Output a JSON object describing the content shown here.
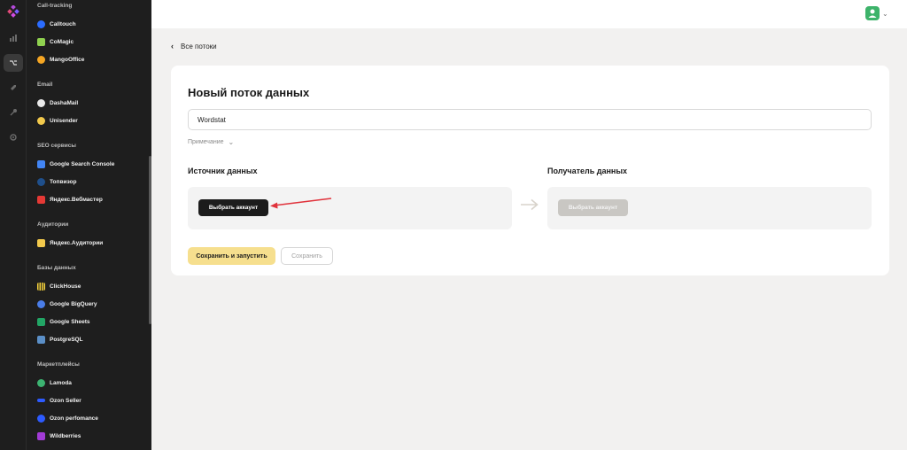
{
  "sidebar": {
    "sections": [
      {
        "title": "Call-tracking",
        "items": [
          {
            "label": "Calltouch",
            "icon": "calltouch-icon",
            "color": "#2b6cff"
          },
          {
            "label": "CoMagic",
            "icon": "comagic-icon",
            "color": "#8fd14f"
          },
          {
            "label": "MangoOffice",
            "icon": "mangooffice-icon",
            "color": "#f5a623"
          }
        ]
      },
      {
        "title": "Email",
        "items": [
          {
            "label": "DashaMail",
            "icon": "dashamail-icon",
            "color": "#e8e8e8"
          },
          {
            "label": "Unisender",
            "icon": "unisender-icon",
            "color": "#f2c94c"
          }
        ]
      },
      {
        "title": "SEO сервисы",
        "items": [
          {
            "label": "Google Search Console",
            "icon": "google-search-console-icon",
            "color": "#4285f4"
          },
          {
            "label": "Топвизор",
            "icon": "topvisor-icon",
            "color": "#1f4f8b"
          },
          {
            "label": "Яндекс.Вебмастер",
            "icon": "yandex-webmaster-icon",
            "color": "#e53935"
          }
        ]
      },
      {
        "title": "Аудитории",
        "items": [
          {
            "label": "Яндекс.Аудитории",
            "icon": "yandex-audiences-icon",
            "color": "#f2c94c"
          }
        ]
      },
      {
        "title": "Базы данных",
        "items": [
          {
            "label": "ClickHouse",
            "icon": "clickhouse-icon",
            "color": "#f6d33c"
          },
          {
            "label": "Google BigQuery",
            "icon": "google-bigquery-icon",
            "color": "#4a7de8"
          },
          {
            "label": "Google Sheets",
            "icon": "google-sheets-icon",
            "color": "#22a565"
          },
          {
            "label": "PostgreSQL",
            "icon": "postgresql-icon",
            "color": "#5b8fc7"
          }
        ]
      },
      {
        "title": "Маркетплейсы",
        "items": [
          {
            "label": "Lamoda",
            "icon": "lamoda-icon",
            "color": "#3cb371"
          },
          {
            "label": "Ozon Seller",
            "icon": "ozon-seller-icon",
            "color": "#2d5bff"
          },
          {
            "label": "Ozon perfomance",
            "icon": "ozon-performance-icon",
            "color": "#2d5bff"
          },
          {
            "label": "Wildberries",
            "icon": "wildberries-icon",
            "color": "#a23bd6"
          }
        ]
      }
    ]
  },
  "breadcrumb": {
    "back_label": "Все потоки"
  },
  "form": {
    "title": "Новый поток данных",
    "name_value": "Wordstat",
    "note_label": "Примечание",
    "source_title": "Источник данных",
    "destination_title": "Получатель данных",
    "select_account_label": "Выбрать аккаунт",
    "select_account_disabled_label": "Выбрать аккаунт",
    "save_and_run_label": "Сохранить и запустить",
    "save_label": "Сохранить"
  },
  "colors": {
    "accent_yellow": "#f6df8e",
    "sidebar_bg": "#1e1e1e",
    "annotation_arrow": "#e0323b",
    "avatar": "#3db36a"
  }
}
